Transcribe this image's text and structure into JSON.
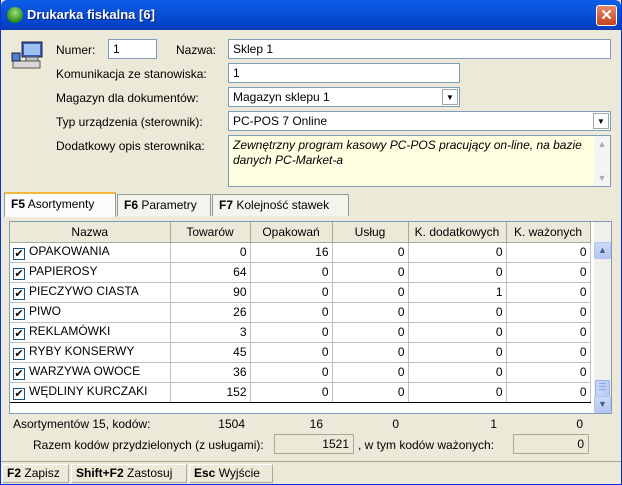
{
  "window": {
    "title": "Drukarka fiskalna [6]",
    "close": "✕"
  },
  "form": {
    "numer_label": "Numer:",
    "numer_value": "1",
    "nazwa_label": "Nazwa:",
    "nazwa_value": "Sklep 1",
    "komunikacja_label": "Komunikacja ze stanowiska:",
    "komunikacja_value": "1",
    "magazyn_label": "Magazyn dla dokumentów:",
    "magazyn_value": "Magazyn sklepu 1",
    "typ_label": "Typ urządzenia (sterownik):",
    "typ_value": "PC-POS 7 Online",
    "opis_label": "Dodatkowy opis sterownika:",
    "opis_value": "Zewnętrzny program kasowy PC-POS pracujący on-line, na bazie danych PC-Market-a"
  },
  "tabs": [
    {
      "key": "F5",
      "label": "Asortymenty",
      "active": true
    },
    {
      "key": "F6",
      "label": "Parametry",
      "active": false
    },
    {
      "key": "F7",
      "label": "Kolejność stawek",
      "active": false
    }
  ],
  "table": {
    "columns": [
      "Nazwa",
      "Towarów",
      "Opakowań",
      "Usług",
      "K. dodatkowych",
      "K. ważonych"
    ],
    "rows": [
      {
        "name": "OPAKOWANIA",
        "checked": true,
        "v": [
          "0",
          "16",
          "0",
          "0",
          "0"
        ]
      },
      {
        "name": "PAPIEROSY",
        "checked": true,
        "v": [
          "64",
          "0",
          "0",
          "0",
          "0"
        ]
      },
      {
        "name": "PIECZYWO CIASTA",
        "checked": true,
        "v": [
          "90",
          "0",
          "0",
          "1",
          "0"
        ]
      },
      {
        "name": "PIWO",
        "checked": true,
        "v": [
          "26",
          "0",
          "0",
          "0",
          "0"
        ]
      },
      {
        "name": "REKLAMÓWKI",
        "checked": true,
        "v": [
          "3",
          "0",
          "0",
          "0",
          "0"
        ]
      },
      {
        "name": "RYBY KONSERWY",
        "checked": true,
        "v": [
          "45",
          "0",
          "0",
          "0",
          "0"
        ]
      },
      {
        "name": "WARZYWA OWOCE",
        "checked": true,
        "v": [
          "36",
          "0",
          "0",
          "0",
          "0"
        ]
      },
      {
        "name": "WĘDLINY KURCZAKI",
        "checked": true,
        "v": [
          "152",
          "0",
          "0",
          "0",
          "0"
        ]
      }
    ]
  },
  "summary": {
    "label": "Asortymentów 15, kodów:",
    "towarow": "1504",
    "opakowan": "16",
    "uslug": "0",
    "dodatkowych": "1",
    "wazonych": "0",
    "razem_label": "Razem kodów przydzielonych (z usługami):",
    "razem_value": "1521",
    "wtym_label": ", w tym kodów ważonych:",
    "wtym_value": "0"
  },
  "statusbar": [
    {
      "key": "F2",
      "label": "Zapisz"
    },
    {
      "key": "Shift+F2",
      "label": "Zastosuj"
    },
    {
      "key": "Esc",
      "label": "Wyjście"
    }
  ]
}
